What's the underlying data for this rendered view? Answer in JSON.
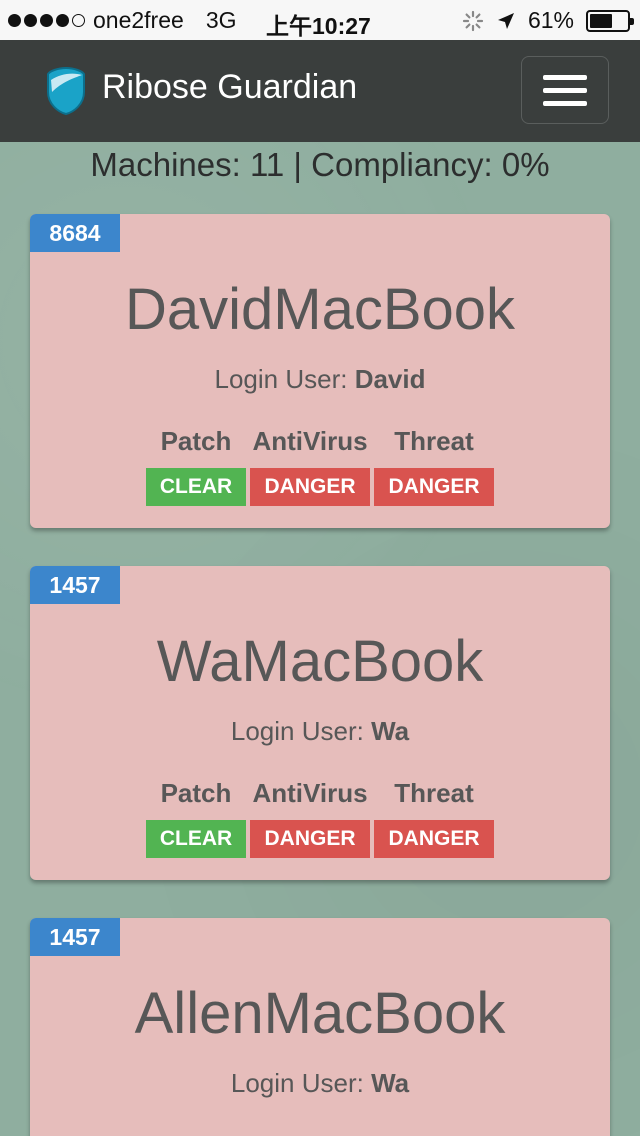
{
  "status_bar": {
    "carrier": "one2free",
    "network": "3G",
    "time": "上午10:27",
    "battery": "61%",
    "battery_level": 0.61
  },
  "navbar": {
    "brand": "Ribose Guardian",
    "logo_icon": "shield-icon",
    "menu_icon": "hamburger-icon"
  },
  "summary": "Machines: 11 | Compliancy: 0%",
  "columns": {
    "patch": "Patch",
    "antivirus": "AntiVirus",
    "threat": "Threat"
  },
  "login_label": "Login User: ",
  "machines": [
    {
      "id": "8684",
      "name": "DavidMacBook",
      "login_user": "David",
      "patch": "CLEAR",
      "antivirus": "DANGER",
      "threat": "DANGER"
    },
    {
      "id": "1457",
      "name": "WaMacBook",
      "login_user": "Wa",
      "patch": "CLEAR",
      "antivirus": "DANGER",
      "threat": "DANGER"
    },
    {
      "id": "1457",
      "name": "AllenMacBook",
      "login_user": "Wa"
    }
  ],
  "colors": {
    "card_bg": "#e6bdbb",
    "id_badge": "#3c86cc",
    "clear": "#52b452",
    "danger": "#d9534f",
    "navbar": "#3a3e3d"
  }
}
